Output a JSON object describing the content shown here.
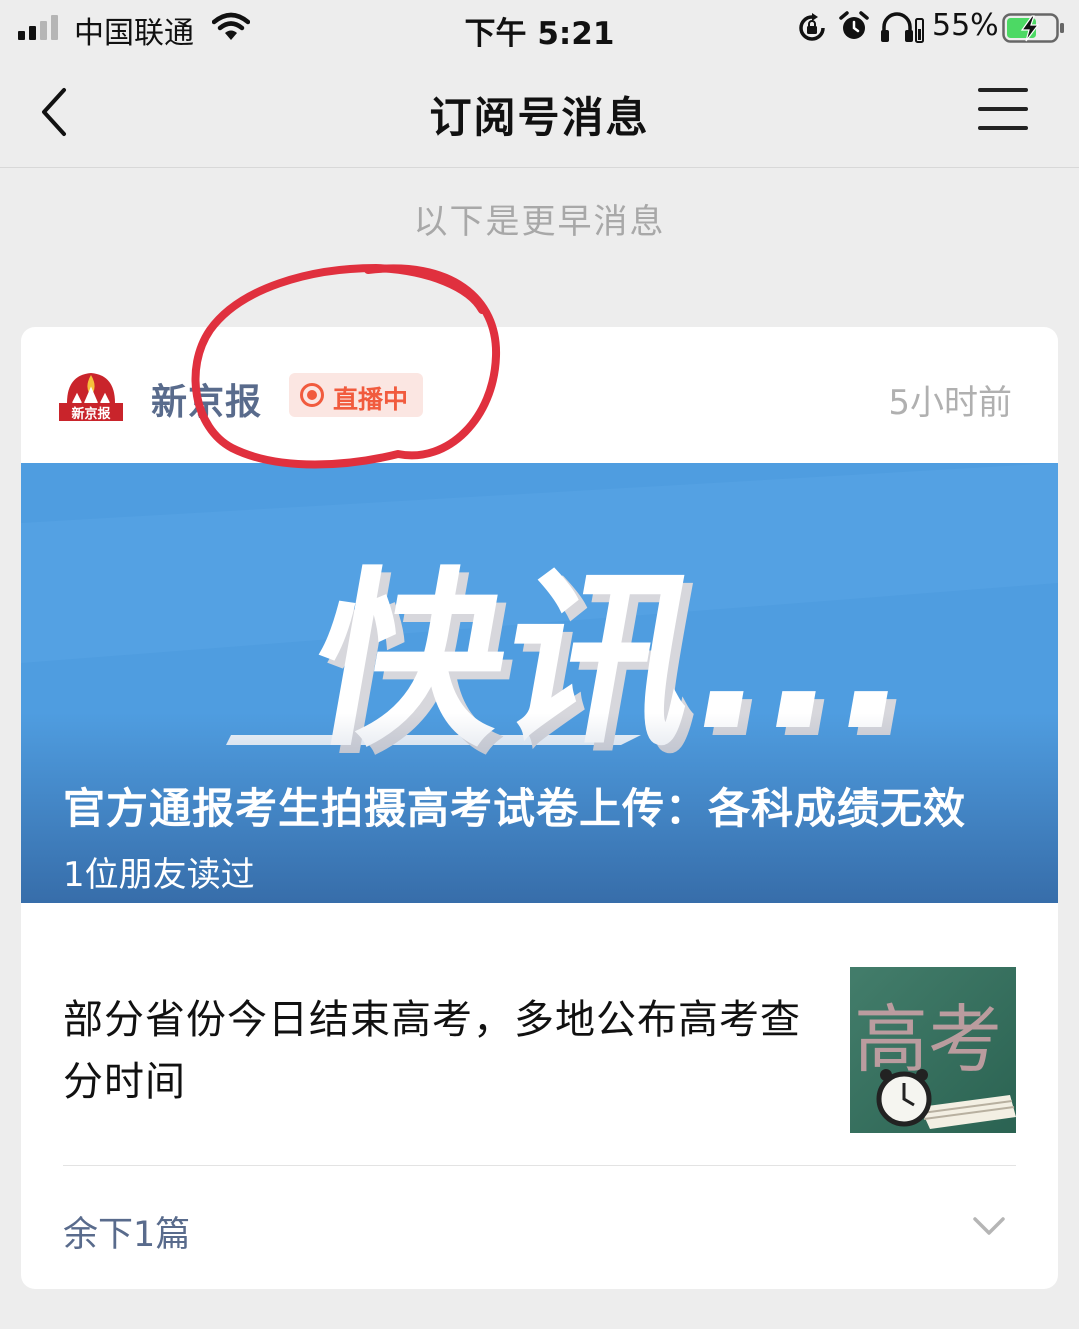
{
  "status_bar": {
    "carrier": "中国联通",
    "time": "下午 5:21",
    "battery_percent": "55%"
  },
  "nav": {
    "title": "订阅号消息"
  },
  "earlier_label": "以下是更早消息",
  "card": {
    "account_name": "新京报",
    "logo_text": "新京报",
    "live_badge": "直播中",
    "time_ago": "5小时前",
    "cover": {
      "headline": "快讯...",
      "title": "官方通报考生拍摄高考试卷上传：各科成绩无效",
      "readers": "1位朋友读过"
    },
    "second_article": {
      "title": "部分省份今日结束高考，多地公布高考查分时间",
      "thumb_text": "高考"
    },
    "remaining": "余下1篇"
  },
  "colors": {
    "page_bg": "#ededed",
    "account_name": "#596b8c",
    "live_red": "#f15b3e",
    "cover_blue": "#4f9de0",
    "annotation_red": "#e0303e"
  }
}
